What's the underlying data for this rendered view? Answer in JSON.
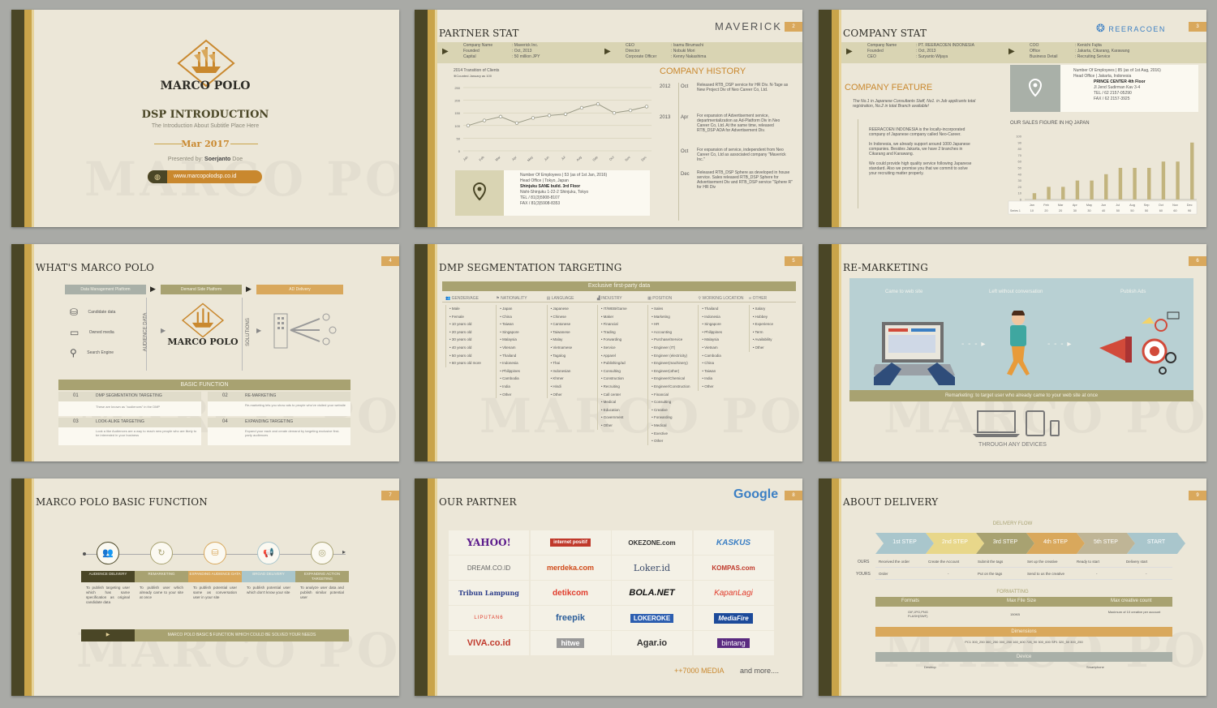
{
  "s1": {
    "logo_text": "MARCO POLO",
    "title": "DSP INTRODUCTION",
    "subtitle": "The Introduction About Subtitle Place Here",
    "date": "Mar 2017",
    "presented_label": "Presented by:",
    "presenter_first": "Soerjanto",
    "presenter_last": "Doe",
    "url": "www.marcopolodsp.co.id"
  },
  "s2": {
    "title": "PARTNER STAT",
    "brand": "MAVERICK",
    "page": "2",
    "info_left": [
      "Company Name",
      "Founded",
      "Capital"
    ],
    "info_left_vals": [
      ": Maverick Inc.",
      ": Oct, 2013",
      ": 50 million JPY"
    ],
    "info_right": [
      "CEO",
      "Director",
      "Corporate Officer"
    ],
    "info_right_vals": [
      ": Isamu Birumachi",
      ": Nobuki Mori",
      ": Kenny Nakashima"
    ],
    "chart_title": "2014 Transition of Clients",
    "chart_sub": "※Counted January as 100",
    "history_title": "COMPANY HISTORY",
    "history": [
      {
        "year": "2012",
        "month": "Oct",
        "text": "Released RTB_DSP service for HR Div. N-Tage as New Project Div of Neo Career Co, Ltd."
      },
      {
        "year": "2013",
        "month": "Apr",
        "text": "For expansion of Advertisement service, departmentalization as Ad-Platform Div in Neo Career Co, Ltd. At the same time, released RTB_DSP ADA for Advertisement Div."
      },
      {
        "year": "",
        "month": "Oct",
        "text": "For expansion of service, independent from Neo Career Co, Ltd as associated company \"Maverick Inc.\""
      },
      {
        "year": "",
        "month": "Dec",
        "text": "Released RTB_DSP Sphere as developed in house service. Sales released RTB_DSP Sphere for Advertisement Div and RTB_DSP service \"Sphere R\" for HR Div"
      }
    ],
    "addr": [
      "Number Of Employees | 53 (as of 1st Jan, 2016)",
      "Head Office | Tokyo, Japan",
      "Shinjuku SANE build. 3rd Floor",
      "Nishi-Shinjuku 1-22-2 Shinjuku, Tokyo",
      "TEL / 81(3)5908-8107",
      "FAX / 81(3)5908-8353"
    ]
  },
  "chart_data": [
    {
      "type": "line",
      "title": "2014 Transition of Clients",
      "categories": [
        "Jan",
        "Feb",
        "Mar",
        "Apr",
        "May",
        "Jun",
        "Jul",
        "Aug",
        "Sep",
        "Oct",
        "Nov",
        "Dec"
      ],
      "values": [
        100,
        120,
        135,
        110,
        130,
        140,
        145,
        170,
        185,
        150,
        160,
        175
      ],
      "ylim": [
        0,
        250
      ],
      "yticks": [
        "250",
        "200",
        "150",
        "100",
        "50",
        "0"
      ]
    },
    {
      "type": "bar",
      "title": "OUR SALES FIGURE IN HQ JAPAN",
      "categories": [
        "Jan",
        "Feb",
        "Mar",
        "Apr",
        "May",
        "Jun",
        "Jul",
        "Aug",
        "Sep",
        "Oct",
        "Nov",
        "Dec"
      ],
      "values": [
        10,
        20,
        20,
        30,
        30,
        40,
        50,
        50,
        50,
        60,
        60,
        90
      ],
      "series_label": "Series 1",
      "ylim": [
        0,
        100
      ],
      "yticks": [
        "100",
        "90",
        "80",
        "70",
        "60",
        "50",
        "40",
        "30",
        "20",
        "10",
        "0"
      ]
    }
  ],
  "s3": {
    "title": "COMPANY STAT",
    "brand": "REERACOEN",
    "page": "3",
    "info_left": [
      "Company Name",
      "Founded",
      "CEO"
    ],
    "info_left_vals": [
      ": PT. REERACOEN INDONESIA",
      ": Oct, 2013",
      ": Suryanto Wijaya"
    ],
    "info_right": [
      "COO",
      "Office",
      "Business Detail"
    ],
    "info_right_vals": [
      ": Kenichi Fujita",
      ": Jakarta, Cikarang, Karawang",
      ": Recruiting Service"
    ],
    "feature_title": "COMPANY FEATURE",
    "feature_intro": "The No.1 in Japanese Consultants Staff, No1. in Job applicants total registration, No.2 in total Branch available!",
    "bullets": [
      "REERACOEN INDONESIA is the locally-incorporated company of Japanese company called Neo-Career.",
      "In Indonesia, we already support around 1000 Japanese companies. Besides Jakarta, we have 2 branches in Cikarang and Karawang.",
      "We could provide high quality service following Japanese standard. Also we promise you that we commit to solve your recruiting matter properly."
    ],
    "addr": [
      "Number Of Employees | 85 (as of 1st Aug, 2016)",
      "Head Office | Jakarta, Indonesia",
      "PRINCE CENTER 4th Floor",
      "Jl Jend Sudirman Kav 3-4",
      "TEL / 62 2157-05290",
      "FAX / 62 2157-3925"
    ],
    "sales_title": "OUR SALES FIGURE IN HQ JAPAN"
  },
  "s4": {
    "title": "WHAT'S MARCO POLO",
    "page": "4",
    "flow": [
      "Data Management Platform",
      "Demand Side Platform",
      "AD Delivery"
    ],
    "left_items": [
      "Candidate data",
      "Owned media",
      "Search Engine"
    ],
    "vert1": "AUDIENCE DATA",
    "vert2": "SOLUTIONS",
    "logo_text": "MARCO POLO",
    "basic_title": "BASIC FUNCTION",
    "funcs": [
      {
        "num": "01",
        "name": "DMP SEGMENTATION TARGETING",
        "desc": "These are known as \"audiences\" in the DMP"
      },
      {
        "num": "02",
        "name": "RE-MARKETING",
        "desc": "Re-marketing lets you show ads to people who've visited your website"
      },
      {
        "num": "03",
        "name": "LOOK-ALIKE TARGETING",
        "desc": "Look a like Audiences are a way to reach new people who are likely to be interested in your business"
      },
      {
        "num": "04",
        "name": "EXPANDING TARGETING",
        "desc": "Expand your each and create demand by targeting exclusive first-party audiences"
      }
    ]
  },
  "s5": {
    "title": "DMP SEGMENTATION TARGETING",
    "page": "5",
    "band": "Exclusive first-party data",
    "cols": [
      {
        "head": "GENDER/AGE",
        "items": [
          "Male",
          "Female",
          "10 years old",
          "20 years old",
          "30 years old",
          "40 years old",
          "50 years old",
          "60 years old more"
        ]
      },
      {
        "head": "NATIONALITY",
        "items": [
          "Japan",
          "China",
          "Taiwan",
          "Singapore",
          "Malaysia",
          "Vitenam",
          "Thailand",
          "Indonesia",
          "Philippines",
          "Cambodia",
          "India",
          "Other"
        ]
      },
      {
        "head": "LANGUAGE",
        "items": [
          "Japanese",
          "Chinese",
          "Cantonese",
          "Taiwanese",
          "Malay",
          "Vietnamese",
          "Tagalog",
          "Thai",
          "Indonesian",
          "Khmer",
          "Hindi",
          "Other"
        ]
      },
      {
        "head": "INDUSTRY",
        "items": [
          "IT/WEB/Game",
          "Maker",
          "Financial",
          "Trading",
          "Forwarding",
          "Service",
          "Apparel",
          "Publishing/ad",
          "Consulting",
          "Construction",
          "Recruiting",
          "Call center",
          "Medical",
          "Education",
          "Government",
          "Other"
        ]
      },
      {
        "head": "POSITION",
        "items": [
          "Sales",
          "Marketing",
          "HR",
          "Accounting",
          "Purchase/Service",
          "Engineer (IT)",
          "Engineer (electricity)",
          "Engineer(machinery)",
          "Engineer(other)",
          "Engineer/Chemical",
          "Engineer/Construction",
          "Financial",
          "Consulting",
          "Creative",
          "Forwarding",
          "Medical",
          "Exective",
          "Other"
        ]
      },
      {
        "head": "WORKING LOCATION",
        "items": [
          "Thailand",
          "Indonesia",
          "Singapore",
          "Philippines",
          "Malaysia",
          "Vietnam",
          "Cambodia",
          "China",
          "Taiwan",
          "India",
          "Other"
        ]
      },
      {
        "head": "OTHER",
        "items": [
          "Salary",
          "Hobbey",
          "Experience",
          "Term",
          "Availability",
          "Other"
        ]
      }
    ]
  },
  "s6": {
    "title": "RE-MARKETING",
    "page": "6",
    "steps": [
      "Came to web site",
      "Left without conversation",
      "Publish Ads"
    ],
    "band": "Remarketing: to target user who already came to your web site at once",
    "devices": "THROUGH ANY DEVICES"
  },
  "s7": {
    "title": "MARCO POLO BASIC FUNCTION",
    "page": "7",
    "funcs": [
      {
        "name": "AUDIENCE DELIVERY",
        "desc": "To publish targeting user which has same specification as original candidate data"
      },
      {
        "name": "REMARKETING",
        "desc": "To publish user which already came to your site at once"
      },
      {
        "name": "EXPANDING AUDIENCE DATA",
        "desc": "To publish potential user same as conversation user in your site"
      },
      {
        "name": "BROAD DELIVERY",
        "desc": "To publish potential user which don't know your site"
      },
      {
        "name": "EXPANDING ACTION TARGETING",
        "desc": "To analyze user data and publish similar potential user"
      }
    ],
    "band_pre": "MARCO POLO BASIC",
    "band_num": "5",
    "band_post": "FUNCTION WHICH COULD BE SOLVED YOUR NEEDS"
  },
  "s8": {
    "title": "OUR PARTNER",
    "brand": "Google",
    "page": "8",
    "partners": [
      "YAHOO!",
      "internet positif",
      "OKEZONE.com",
      "KASKUS",
      "DREAM.CO.ID",
      "merdeka.com",
      "Loker.id",
      "KOMPAS.com",
      "Tribun Lampung",
      "detikcom",
      "BOLA.NET",
      "KapanLagi",
      "LIPUTAN6",
      "freepik",
      "LOKEROKE",
      "MediaFire",
      "VIVA.co.id",
      "hitwe",
      "Agar.io",
      "bintang"
    ],
    "media_count": "++7000 MEDIA",
    "more": "and more...."
  },
  "s9": {
    "title": "ABOUT DELIVERY",
    "page": "9",
    "flow_title": "DELIVERY FLOW",
    "steps": [
      "1st STEP",
      "2nd STEP",
      "3rd STEP",
      "4th STEP",
      "5th STEP",
      "START"
    ],
    "row_ours": "OURS",
    "row_yours": "YOURS",
    "ours": [
      "Received the order",
      "Create the Account",
      "Submit the tags",
      "Set up the creative",
      "Ready to start",
      "Delivery start"
    ],
    "yours": [
      "Order",
      "-",
      "Put on the tags",
      "Send to us the creative",
      "-",
      "-"
    ],
    "formatting": "FORMATTING",
    "fmt_heads": [
      "Formats",
      "Max File Size",
      "Max creative count"
    ],
    "fmt_vals": [
      "GIF,JPG,PNG FLASH(SWF)",
      "150KB",
      "Maximum of 10 creative per account"
    ],
    "dimensions": "Dimensions",
    "dims": "PC1  300_250  300_250  300_250  160_600  728_90  300_600  SP1  320_50  300_250",
    "device": "Device",
    "device_vals": [
      "Desktop",
      "Smartphone"
    ]
  }
}
